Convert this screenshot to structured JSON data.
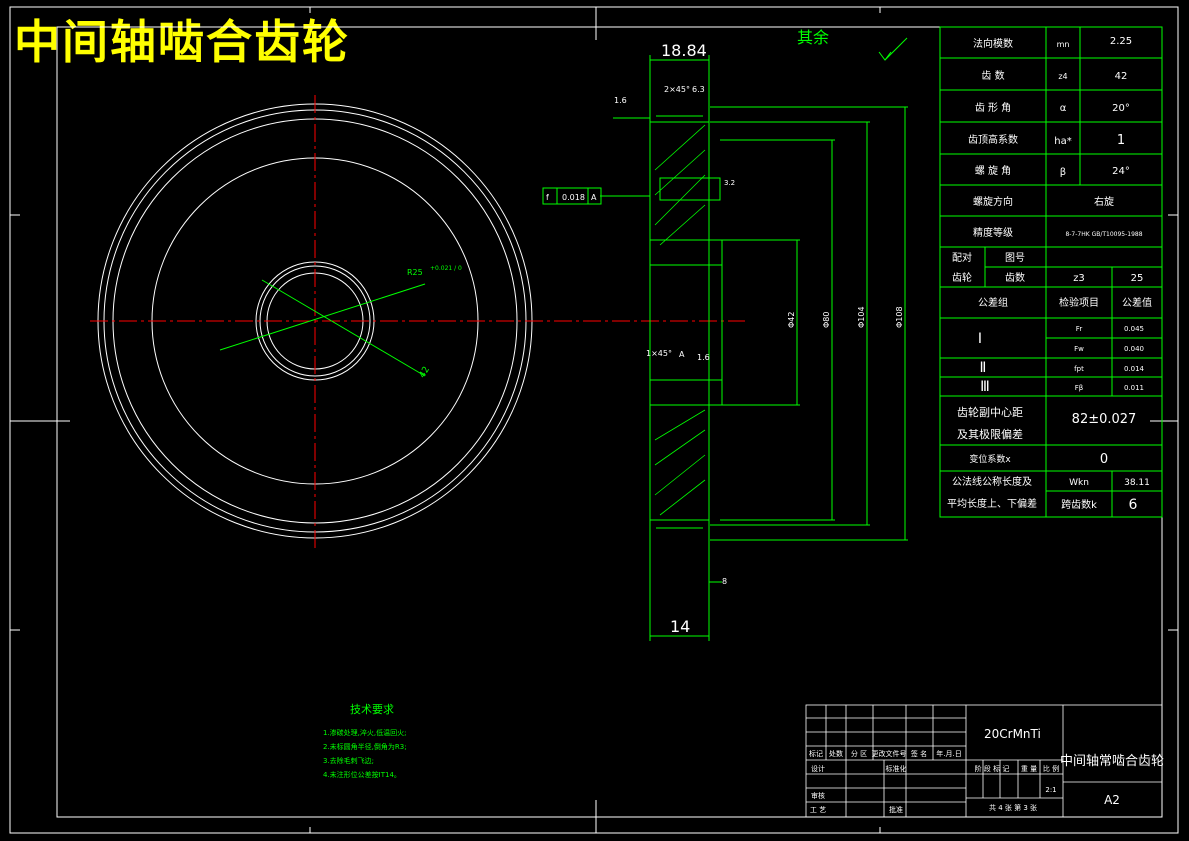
{
  "title": "中间轴啮合齿轮",
  "surface_note": "其余",
  "dims": {
    "top_width": "18.84",
    "chamfer": "2×45°",
    "chamfer_r": "6.3",
    "roughness_left": "1.6",
    "roughness_slot": "3.2",
    "geo_tol": [
      "f",
      "0.018",
      "A"
    ],
    "bore_r": "R25",
    "bore_tol": "+0.021 / 0",
    "bore_dim": "42",
    "datum": "A",
    "chamfer_bottom": "1×45°",
    "roughness_bottom": "1.6",
    "dia1": "Φ42",
    "dia2": "Φ80",
    "dia3": "Φ104",
    "dia4": "Φ108",
    "bottom_width": "14",
    "small_dim": "8"
  },
  "params": [
    {
      "name": "法向模数",
      "sym": "mn",
      "val": "2.25"
    },
    {
      "name": "齿 数",
      "sym": "z4",
      "val": "42"
    },
    {
      "name": "齿 形 角",
      "sym": "α",
      "val": "20°"
    },
    {
      "name": "齿顶高系数",
      "sym": "ha*",
      "val": "1"
    },
    {
      "name": "螺 旋 角",
      "sym": "β",
      "val": "24°"
    },
    {
      "name": "螺旋方向",
      "sym": "",
      "val": "右旋"
    },
    {
      "name": "精度等级",
      "sym": "",
      "val": "8-7-7HK GB/T10095-1988"
    }
  ],
  "mating": {
    "label1": "配对",
    "label2": "齿轮",
    "col1": "图号",
    "col2": "齿数",
    "sym": "z3",
    "val": "25"
  },
  "tol_head": {
    "group": "公差组",
    "item": "检验项目",
    "val": "公差值"
  },
  "tol_groups": [
    {
      "group": "Ⅰ",
      "rows": [
        {
          "sym": "Fr",
          "val": "0.045"
        },
        {
          "sym": "Fw",
          "val": "0.040"
        }
      ]
    },
    {
      "group": "Ⅱ",
      "rows": [
        {
          "sym": "fpt",
          "val": "0.014"
        }
      ]
    },
    {
      "group": "Ⅲ",
      "rows": [
        {
          "sym": "Fβ",
          "val": "0.011"
        }
      ]
    }
  ],
  "center_dist": {
    "label1": "齿轮副中心距",
    "label2": "及其极限偏差",
    "val": "82±0.027"
  },
  "shift": {
    "label": "变位系数x",
    "val": "0"
  },
  "wkn": {
    "label1": "公法线公称长度及",
    "label2": "平均长度上、下偏差",
    "sym": "Wkn",
    "val": "38.11",
    "teeth_label": "跨齿数k",
    "teeth": "6"
  },
  "tech": {
    "heading": "技术要求",
    "items": [
      "1.渗碳处理,淬火,低温回火;",
      "2.未标圆角半径,倒角为R3;",
      "3.去除毛刺飞边;",
      "4.未注形位公差按IT14。"
    ]
  },
  "titleblock": {
    "material": "20CrMnTi",
    "name": "中间轴常啮合齿轮",
    "size": "A2",
    "scale": "2:1",
    "hdr": [
      "标记",
      "处数",
      "分 区",
      "更改文件号",
      "签 名",
      "年.月.日"
    ],
    "design": "设计",
    "std": "标准化",
    "review": "审核",
    "process": "工 艺",
    "approve": "批准",
    "stage_hdr": [
      "阶 段 标 记",
      "重 量",
      "比 例"
    ],
    "sheets": "共 4 张  第 3 张"
  }
}
